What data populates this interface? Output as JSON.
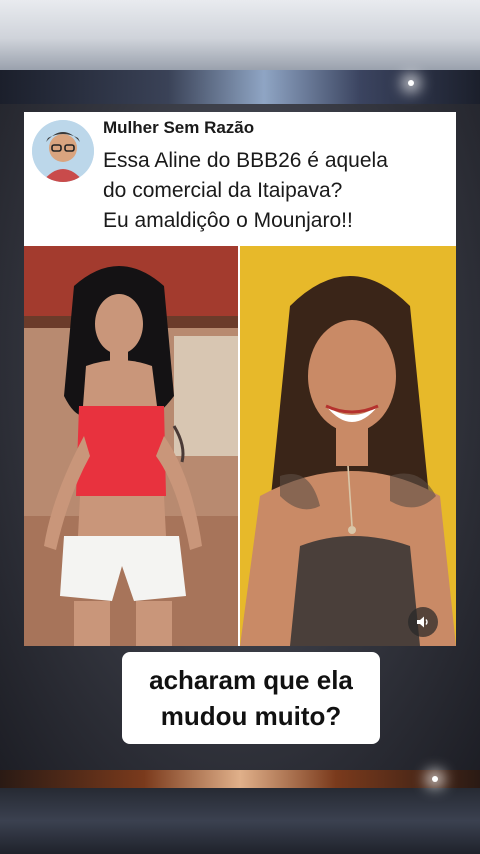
{
  "post": {
    "author": "Mulher Sem Razão",
    "text_lines": [
      "Essa Aline do BBB26 é aquela",
      "do comercial da Itaipava?",
      "Eu amaldiçôo o Mounjaro!!"
    ]
  },
  "caption": {
    "lines": [
      "acharam que ela",
      "mudou muito?"
    ]
  },
  "icons": {
    "volume": "speaker-volume-icon",
    "avatar": "profile-avatar"
  },
  "colors": {
    "card_background": "#ffffff",
    "right_photo_background": "#e7b92a",
    "left_top_red": "#e8323e"
  }
}
